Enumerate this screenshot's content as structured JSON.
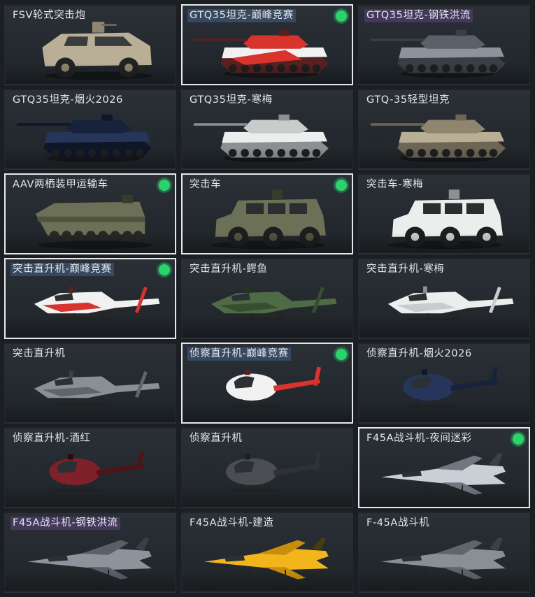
{
  "colors": {
    "selected_border": "#e6e9ec",
    "status_dot": "#2bd36d",
    "card_bg": "#262c31",
    "label_text": "#e4e8ec"
  },
  "items": [
    {
      "label": "FSV轮式突击炮",
      "kind": "car",
      "skin": "desert",
      "selected": false,
      "indicator": false,
      "highlight": "none"
    },
    {
      "label": "GTQ35坦克-巅峰竞赛",
      "kind": "tank",
      "skin": "red",
      "selected": true,
      "indicator": true,
      "highlight": "blue"
    },
    {
      "label": "GTQ35坦克-钢铁洪流",
      "kind": "tank",
      "skin": "steel",
      "selected": false,
      "indicator": false,
      "highlight": "purple"
    },
    {
      "label": "GTQ35坦克-烟火2026",
      "kind": "tank",
      "skin": "navy",
      "selected": false,
      "indicator": false,
      "highlight": "none"
    },
    {
      "label": "GTQ35坦克-寒梅",
      "kind": "tank",
      "skin": "white",
      "selected": false,
      "indicator": false,
      "highlight": "none"
    },
    {
      "label": "GTQ-35轻型坦克",
      "kind": "tank",
      "skin": "desert",
      "selected": false,
      "indicator": false,
      "highlight": "none"
    },
    {
      "label": "AAV两栖装甲运输车",
      "kind": "amph",
      "skin": "olive",
      "selected": true,
      "indicator": true,
      "highlight": "none"
    },
    {
      "label": "突击车",
      "kind": "truck",
      "skin": "olive",
      "selected": true,
      "indicator": true,
      "highlight": "none"
    },
    {
      "label": "突击车-寒梅",
      "kind": "truck",
      "skin": "white",
      "selected": false,
      "indicator": false,
      "highlight": "none"
    },
    {
      "label": "突击直升机-巅峰竞赛",
      "kind": "apache",
      "skin": "red",
      "selected": true,
      "indicator": true,
      "highlight": "blue"
    },
    {
      "label": "突击直升机-鳄鱼",
      "kind": "apache",
      "skin": "green",
      "selected": false,
      "indicator": false,
      "highlight": "none"
    },
    {
      "label": "突击直升机-寒梅",
      "kind": "apache",
      "skin": "white",
      "selected": false,
      "indicator": false,
      "highlight": "none"
    },
    {
      "label": "突击直升机",
      "kind": "apache",
      "skin": "grey",
      "selected": false,
      "indicator": false,
      "highlight": "none"
    },
    {
      "label": "侦察直升机-巅峰竞赛",
      "kind": "scout",
      "skin": "red",
      "selected": true,
      "indicator": true,
      "highlight": "blue"
    },
    {
      "label": "侦察直升机-烟火2026",
      "kind": "scout",
      "skin": "navy",
      "selected": false,
      "indicator": false,
      "highlight": "none"
    },
    {
      "label": "侦察直升机-酒红",
      "kind": "scout",
      "skin": "wine",
      "selected": false,
      "indicator": false,
      "highlight": "none"
    },
    {
      "label": "侦察直升机",
      "kind": "scout",
      "skin": "dark",
      "selected": false,
      "indicator": false,
      "highlight": "none"
    },
    {
      "label": "F45A战斗机-夜间迷彩",
      "kind": "jet",
      "skin": "camo",
      "selected": true,
      "indicator": true,
      "highlight": "none"
    },
    {
      "label": "F45A战斗机-钢铁洪流",
      "kind": "jet",
      "skin": "steel",
      "selected": false,
      "indicator": false,
      "highlight": "purple"
    },
    {
      "label": "F45A战斗机-建造",
      "kind": "jet",
      "skin": "yellow",
      "selected": false,
      "indicator": false,
      "highlight": "none"
    },
    {
      "label": "F-45A战斗机",
      "kind": "jet",
      "skin": "grey",
      "selected": false,
      "indicator": false,
      "highlight": "none"
    }
  ]
}
